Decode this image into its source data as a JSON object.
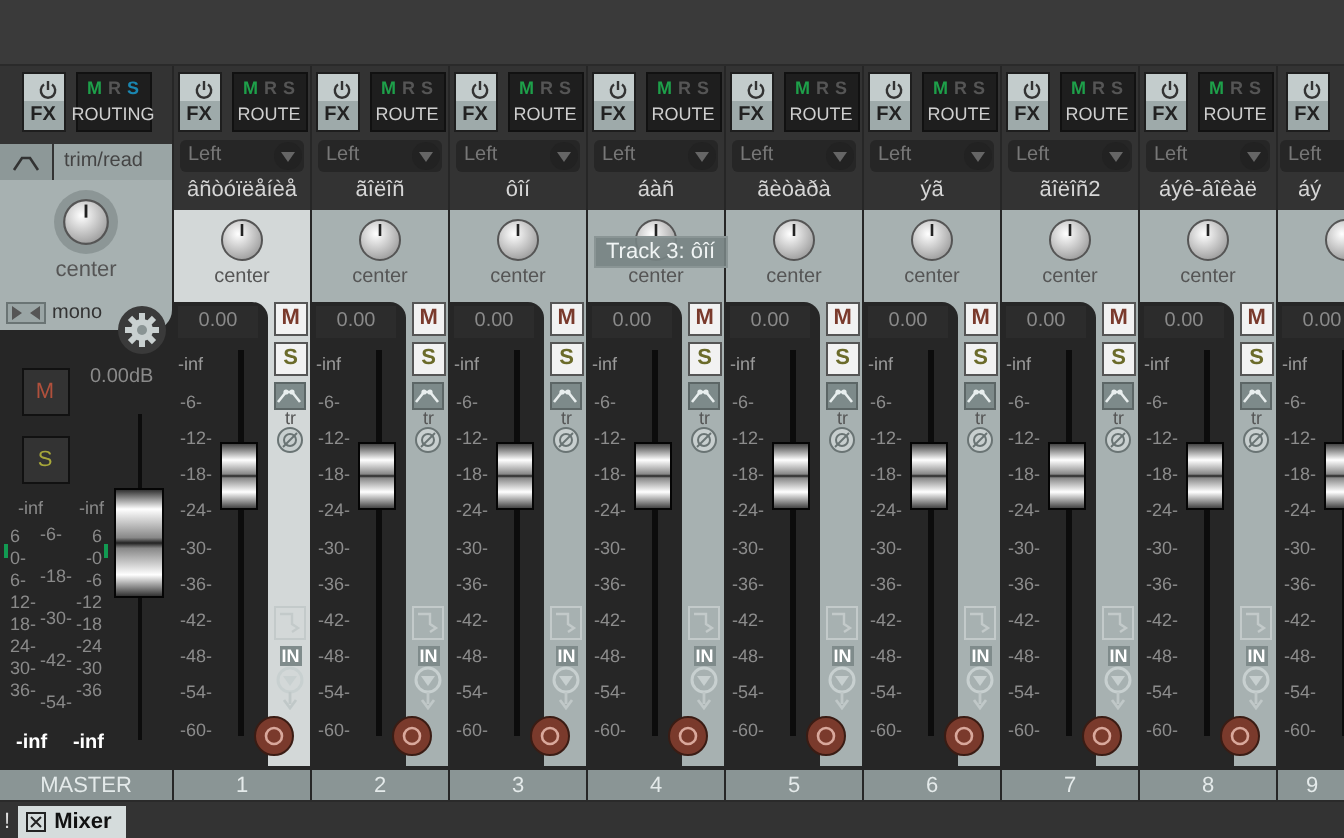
{
  "master": {
    "fx_button": "FX",
    "routing_flags": [
      {
        "text": "M",
        "color": "#1ea04a"
      },
      {
        "text": "R",
        "color": "#555555"
      },
      {
        "text": "S",
        "color": "#1a86b0"
      }
    ],
    "routing_button": "ROUTING",
    "automation_mode": "trim/read",
    "pan_label": "center",
    "mono_button": "mono",
    "mute_button": "M",
    "solo_button": "S",
    "volume": "0.00dB",
    "fader": {
      "level": 0.66
    },
    "peaks": [
      "-inf",
      "-inf"
    ],
    "meter_left_scale": [
      "6",
      "0-",
      "6-",
      "12-",
      "18-",
      "24-",
      "30-",
      "36-"
    ],
    "meter_mid_scale": [
      "-6-",
      "-18-",
      "-30-",
      "-42-",
      "-54-"
    ],
    "meter_right_scale": [
      "6",
      "-0",
      "-6",
      "-12",
      "-18",
      "-24",
      "-30",
      "-36"
    ],
    "meter_readouts": [
      "-inf",
      "-inf"
    ],
    "label": "MASTER"
  },
  "tracks": [
    {
      "kind": "full",
      "number": "1",
      "name": "âñòóïëåíèå",
      "selected": true,
      "fx_button": "FX",
      "routing_flags": [
        {
          "text": "M",
          "color": "#1ea04a"
        },
        {
          "text": "R",
          "color": "#555555"
        },
        {
          "text": "S",
          "color": "#555555"
        }
      ],
      "route_button": "ROUTE",
      "input": "Left",
      "pan_label": "center",
      "volume": "0.00",
      "peak": "-inf",
      "scale": [
        "-6-",
        "-12-",
        "-18-",
        "-24-",
        "-30-",
        "-36-",
        "-42-",
        "-48-",
        "-54-",
        "-60-"
      ],
      "mute_button": "M",
      "solo_button": "S",
      "trim_label": "tr",
      "monitor_label": "IN",
      "fader": {
        "level": 0.71
      }
    },
    {
      "kind": "full",
      "number": "2",
      "name": "ãîëîñ",
      "selected": false,
      "fx_button": "FX",
      "routing_flags": [
        {
          "text": "M",
          "color": "#1ea04a"
        },
        {
          "text": "R",
          "color": "#555555"
        },
        {
          "text": "S",
          "color": "#555555"
        }
      ],
      "route_button": "ROUTE",
      "input": "Left",
      "pan_label": "center",
      "volume": "0.00",
      "peak": "-inf",
      "scale": [
        "-6-",
        "-12-",
        "-18-",
        "-24-",
        "-30-",
        "-36-",
        "-42-",
        "-48-",
        "-54-",
        "-60-"
      ],
      "mute_button": "M",
      "solo_button": "S",
      "trim_label": "tr",
      "monitor_label": "IN",
      "fader": {
        "level": 0.71
      }
    },
    {
      "kind": "full",
      "number": "3",
      "name": "ôîí",
      "selected": false,
      "fx_button": "FX",
      "routing_flags": [
        {
          "text": "M",
          "color": "#1ea04a"
        },
        {
          "text": "R",
          "color": "#555555"
        },
        {
          "text": "S",
          "color": "#555555"
        }
      ],
      "route_button": "ROUTE",
      "input": "Left",
      "pan_label": "center",
      "volume": "0.00",
      "peak": "-inf",
      "scale": [
        "-6-",
        "-12-",
        "-18-",
        "-24-",
        "-30-",
        "-36-",
        "-42-",
        "-48-",
        "-54-",
        "-60-"
      ],
      "mute_button": "M",
      "solo_button": "S",
      "trim_label": "tr",
      "monitor_label": "IN",
      "fader": {
        "level": 0.71
      }
    },
    {
      "kind": "full",
      "number": "4",
      "name": "áàñ",
      "selected": false,
      "fx_button": "FX",
      "routing_flags": [
        {
          "text": "M",
          "color": "#1ea04a"
        },
        {
          "text": "R",
          "color": "#555555"
        },
        {
          "text": "S",
          "color": "#555555"
        }
      ],
      "route_button": "ROUTE",
      "input": "Left",
      "pan_label": "center",
      "volume": "0.00",
      "peak": "-inf",
      "scale": [
        "-6-",
        "-12-",
        "-18-",
        "-24-",
        "-30-",
        "-36-",
        "-42-",
        "-48-",
        "-54-",
        "-60-"
      ],
      "mute_button": "M",
      "solo_button": "S",
      "trim_label": "tr",
      "monitor_label": "IN",
      "fader": {
        "level": 0.71
      }
    },
    {
      "kind": "full",
      "number": "5",
      "name": "ãèòàðà",
      "selected": false,
      "fx_button": "FX",
      "routing_flags": [
        {
          "text": "M",
          "color": "#1ea04a"
        },
        {
          "text": "R",
          "color": "#555555"
        },
        {
          "text": "S",
          "color": "#555555"
        }
      ],
      "route_button": "ROUTE",
      "input": "Left",
      "pan_label": "center",
      "volume": "0.00",
      "peak": "-inf",
      "scale": [
        "-6-",
        "-12-",
        "-18-",
        "-24-",
        "-30-",
        "-36-",
        "-42-",
        "-48-",
        "-54-",
        "-60-"
      ],
      "mute_button": "M",
      "solo_button": "S",
      "trim_label": "tr",
      "monitor_label": "IN",
      "fader": {
        "level": 0.71
      }
    },
    {
      "kind": "full",
      "number": "6",
      "name": "ýã",
      "selected": false,
      "fx_button": "FX",
      "routing_flags": [
        {
          "text": "M",
          "color": "#1ea04a"
        },
        {
          "text": "R",
          "color": "#555555"
        },
        {
          "text": "S",
          "color": "#555555"
        }
      ],
      "route_button": "ROUTE",
      "input": "Left",
      "pan_label": "center",
      "volume": "0.00",
      "peak": "-inf",
      "scale": [
        "-6-",
        "-12-",
        "-18-",
        "-24-",
        "-30-",
        "-36-",
        "-42-",
        "-48-",
        "-54-",
        "-60-"
      ],
      "mute_button": "M",
      "solo_button": "S",
      "trim_label": "tr",
      "monitor_label": "IN",
      "fader": {
        "level": 0.71
      }
    },
    {
      "kind": "full",
      "number": "7",
      "name": "ãîëîñ2",
      "selected": false,
      "fx_button": "FX",
      "routing_flags": [
        {
          "text": "M",
          "color": "#1ea04a"
        },
        {
          "text": "R",
          "color": "#555555"
        },
        {
          "text": "S",
          "color": "#555555"
        }
      ],
      "route_button": "ROUTE",
      "input": "Left",
      "pan_label": "center",
      "volume": "0.00",
      "peak": "-inf",
      "scale": [
        "-6-",
        "-12-",
        "-18-",
        "-24-",
        "-30-",
        "-36-",
        "-42-",
        "-48-",
        "-54-",
        "-60-"
      ],
      "mute_button": "M",
      "solo_button": "S",
      "trim_label": "tr",
      "monitor_label": "IN",
      "fader": {
        "level": 0.71
      }
    },
    {
      "kind": "full",
      "number": "8",
      "name": "áýê-âîêàë",
      "selected": false,
      "fx_button": "FX",
      "routing_flags": [
        {
          "text": "M",
          "color": "#1ea04a"
        },
        {
          "text": "R",
          "color": "#555555"
        },
        {
          "text": "S",
          "color": "#555555"
        }
      ],
      "route_button": "ROUTE",
      "input": "Left",
      "pan_label": "center",
      "volume": "0.00",
      "peak": "-inf",
      "scale": [
        "-6-",
        "-12-",
        "-18-",
        "-24-",
        "-30-",
        "-36-",
        "-42-",
        "-48-",
        "-54-",
        "-60-"
      ],
      "mute_button": "M",
      "solo_button": "S",
      "trim_label": "tr",
      "monitor_label": "IN",
      "fader": {
        "level": 0.71
      }
    },
    {
      "kind": "partial",
      "number": "9",
      "name": "áý",
      "selected": false,
      "fx_button": "FX",
      "input": "Left",
      "volume": "0.00",
      "peak": "-inf",
      "scale": [
        "-6-",
        "-12-",
        "-18-",
        "-24-",
        "-30-",
        "-36-",
        "-42-",
        "-48-",
        "-54-",
        "-60-"
      ],
      "fader": {
        "level": 0.71
      }
    }
  ],
  "tooltip": {
    "text": "Track 3: ôîí"
  },
  "dock": {
    "marker": "!",
    "tabs": [
      {
        "label": "Mixer",
        "selected": true
      }
    ]
  }
}
